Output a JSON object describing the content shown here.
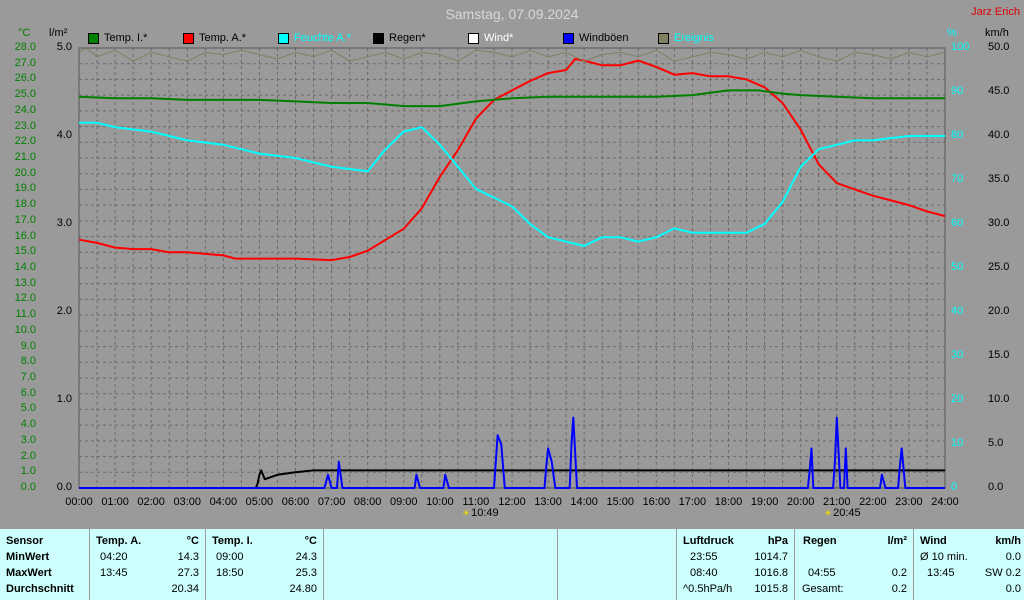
{
  "header": {
    "title": "Samstag, 07.09.2024",
    "author": "Jarz Erich"
  },
  "units": {
    "temp": "°C",
    "rain": "l/m²",
    "humidity": "%",
    "wind": "km/h"
  },
  "legend": [
    {
      "label": "Temp. I.*",
      "color": "#008000",
      "text_color": "#000000"
    },
    {
      "label": "Temp. A.*",
      "color": "#ff0000",
      "text_color": "#000000"
    },
    {
      "label": "Feuchte A.*",
      "color": "#00ffff",
      "text_color": "#00ffff"
    },
    {
      "label": "Regen*",
      "color": "#000000",
      "text_color": "#000000"
    },
    {
      "label": "Wind*",
      "color": "#ffffff",
      "text_color": "#ffffff"
    },
    {
      "label": "Windböen",
      "color": "#0000ff",
      "text_color": "#000000"
    },
    {
      "label": "Ereignis",
      "color": "#808060",
      "text_color": "#00ffff"
    }
  ],
  "colors": {
    "temp_axis": "#008000",
    "humidity_axis": "#00ffff",
    "wind_axis": "#000000",
    "plot_bg": "#9a9a9a",
    "grid": "#6a6a6a"
  },
  "sun": {
    "sunrise": "10:49",
    "sunset": "20:45"
  },
  "chart_data": {
    "type": "line",
    "title": "Samstag, 07.09.2024",
    "grid": true,
    "x": {
      "range": [
        0,
        24
      ],
      "ticks": [
        "00:00",
        "01:00",
        "02:00",
        "03:00",
        "04:00",
        "05:00",
        "06:00",
        "07:00",
        "08:00",
        "09:00",
        "10:00",
        "11:00",
        "12:00",
        "13:00",
        "14:00",
        "15:00",
        "16:00",
        "17:00",
        "18:00",
        "19:00",
        "20:00",
        "21:00",
        "22:00",
        "23:00",
        "24:00"
      ]
    },
    "axes": {
      "temp": {
        "ylim": [
          0,
          28
        ],
        "ticks": [
          "0.0",
          "1.0",
          "2.0",
          "3.0",
          "4.0",
          "5.0",
          "6.0",
          "7.0",
          "8.0",
          "9.0",
          "10.0",
          "11.0",
          "12.0",
          "13.0",
          "14.0",
          "15.0",
          "16.0",
          "17.0",
          "18.0",
          "19.0",
          "20.0",
          "21.0",
          "22.0",
          "23.0",
          "24.0",
          "25.0",
          "26.0",
          "27.0",
          "28.0"
        ]
      },
      "rain": {
        "ylim": [
          0,
          5
        ],
        "ticks": [
          "0.0",
          "1.0",
          "2.0",
          "3.0",
          "4.0",
          "5.0"
        ]
      },
      "humidity": {
        "ylim": [
          0,
          100
        ],
        "ticks": [
          "0",
          "10",
          "20",
          "30",
          "40",
          "50",
          "60",
          "70",
          "80",
          "90",
          "100"
        ]
      },
      "wind": {
        "ylim": [
          0,
          50
        ],
        "ticks": [
          "0.0",
          "5.0",
          "10.0",
          "15.0",
          "20.0",
          "25.0",
          "30.0",
          "35.0",
          "40.0",
          "45.0",
          "50.0"
        ]
      }
    },
    "series": [
      {
        "name": "Temp. A.*",
        "axis": "temp",
        "color": "#ff0000",
        "points": [
          [
            0,
            15.8
          ],
          [
            0.5,
            15.6
          ],
          [
            1,
            15.3
          ],
          [
            1.5,
            15.2
          ],
          [
            2,
            15.2
          ],
          [
            2.5,
            15.0
          ],
          [
            3,
            15.0
          ],
          [
            3.5,
            14.9
          ],
          [
            4,
            14.8
          ],
          [
            4.33,
            14.6
          ],
          [
            5,
            14.6
          ],
          [
            6,
            14.6
          ],
          [
            7,
            14.5
          ],
          [
            7.5,
            14.7
          ],
          [
            8,
            15.1
          ],
          [
            8.5,
            15.8
          ],
          [
            9,
            16.5
          ],
          [
            9.5,
            17.8
          ],
          [
            10,
            19.8
          ],
          [
            10.5,
            21.5
          ],
          [
            11,
            23.5
          ],
          [
            11.5,
            24.7
          ],
          [
            12,
            25.3
          ],
          [
            12.5,
            25.9
          ],
          [
            13,
            26.4
          ],
          [
            13.5,
            26.6
          ],
          [
            13.75,
            27.3
          ],
          [
            14,
            27.2
          ],
          [
            14.5,
            26.9
          ],
          [
            15,
            26.9
          ],
          [
            15.5,
            27.2
          ],
          [
            16,
            26.8
          ],
          [
            16.5,
            26.3
          ],
          [
            17,
            26.4
          ],
          [
            17.5,
            26.2
          ],
          [
            18,
            26.2
          ],
          [
            18.5,
            26.0
          ],
          [
            19,
            25.5
          ],
          [
            19.5,
            24.5
          ],
          [
            20,
            22.8
          ],
          [
            20.5,
            20.6
          ],
          [
            21,
            19.4
          ],
          [
            21.5,
            19.0
          ],
          [
            22,
            18.6
          ],
          [
            22.5,
            18.3
          ],
          [
            23,
            18.0
          ],
          [
            23.5,
            17.6
          ],
          [
            24,
            17.3
          ]
        ]
      },
      {
        "name": "Temp. I.*",
        "axis": "temp",
        "color": "#008000",
        "points": [
          [
            0,
            24.9
          ],
          [
            1,
            24.8
          ],
          [
            2,
            24.8
          ],
          [
            3,
            24.7
          ],
          [
            4,
            24.7
          ],
          [
            5,
            24.7
          ],
          [
            6,
            24.6
          ],
          [
            7,
            24.5
          ],
          [
            8,
            24.5
          ],
          [
            9,
            24.3
          ],
          [
            10,
            24.3
          ],
          [
            11,
            24.6
          ],
          [
            12,
            24.8
          ],
          [
            13,
            24.9
          ],
          [
            14,
            24.9
          ],
          [
            15,
            24.9
          ],
          [
            16,
            24.9
          ],
          [
            17,
            25.0
          ],
          [
            18,
            25.3
          ],
          [
            18.83,
            25.3
          ],
          [
            19.5,
            25.1
          ],
          [
            20,
            25.0
          ],
          [
            21,
            24.9
          ],
          [
            22,
            24.8
          ],
          [
            23,
            24.8
          ],
          [
            24,
            24.8
          ]
        ]
      },
      {
        "name": "Feuchte A.*",
        "axis": "humidity",
        "color": "#00ffff",
        "points": [
          [
            0,
            83
          ],
          [
            0.5,
            83
          ],
          [
            1,
            82
          ],
          [
            2,
            81
          ],
          [
            3,
            79
          ],
          [
            4,
            78
          ],
          [
            5,
            76
          ],
          [
            6,
            75
          ],
          [
            7,
            73
          ],
          [
            8,
            72
          ],
          [
            8.5,
            77
          ],
          [
            9,
            81
          ],
          [
            9.5,
            82
          ],
          [
            10,
            78
          ],
          [
            10.5,
            73
          ],
          [
            11,
            68
          ],
          [
            11.5,
            66
          ],
          [
            12,
            64
          ],
          [
            12.5,
            60
          ],
          [
            13,
            57
          ],
          [
            14,
            55
          ],
          [
            14.5,
            57
          ],
          [
            15,
            57
          ],
          [
            15.5,
            56
          ],
          [
            16,
            57
          ],
          [
            16.5,
            59
          ],
          [
            17,
            58
          ],
          [
            18,
            58
          ],
          [
            18.5,
            58
          ],
          [
            19,
            60
          ],
          [
            19.5,
            65
          ],
          [
            20,
            73
          ],
          [
            20.5,
            77
          ],
          [
            21,
            78
          ],
          [
            21.5,
            79
          ],
          [
            22,
            79
          ],
          [
            23,
            80
          ],
          [
            23.5,
            80
          ],
          [
            24,
            80
          ]
        ]
      },
      {
        "name": "Regen*",
        "axis": "rain",
        "color": "#000000",
        "points": [
          [
            0,
            0
          ],
          [
            4.9,
            0
          ],
          [
            4.95,
            0.05
          ],
          [
            5.0,
            0.15
          ],
          [
            5.05,
            0.2
          ],
          [
            5.15,
            0.1
          ],
          [
            5.5,
            0.15
          ],
          [
            6,
            0.18
          ],
          [
            6.5,
            0.2
          ],
          [
            7,
            0.2
          ],
          [
            24,
            0.2
          ]
        ]
      },
      {
        "name": "Windböen",
        "axis": "wind",
        "color": "#0000ff",
        "points": [
          [
            0,
            0
          ],
          [
            6.8,
            0
          ],
          [
            6.9,
            1.5
          ],
          [
            7.0,
            0
          ],
          [
            7.15,
            0
          ],
          [
            7.2,
            3
          ],
          [
            7.3,
            0
          ],
          [
            9.3,
            0
          ],
          [
            9.35,
            1.5
          ],
          [
            9.45,
            0
          ],
          [
            10.1,
            0
          ],
          [
            10.15,
            1.5
          ],
          [
            10.25,
            0
          ],
          [
            11.5,
            0
          ],
          [
            11.55,
            3
          ],
          [
            11.6,
            6
          ],
          [
            11.7,
            5
          ],
          [
            11.8,
            0
          ],
          [
            12.9,
            0
          ],
          [
            12.95,
            2.5
          ],
          [
            13.0,
            4.5
          ],
          [
            13.1,
            3
          ],
          [
            13.2,
            0
          ],
          [
            13.6,
            0
          ],
          [
            13.65,
            5
          ],
          [
            13.7,
            8
          ],
          [
            13.8,
            0
          ],
          [
            20.2,
            0
          ],
          [
            20.25,
            2
          ],
          [
            20.3,
            4.5
          ],
          [
            20.35,
            0
          ],
          [
            20.9,
            0
          ],
          [
            20.95,
            3
          ],
          [
            21.0,
            8
          ],
          [
            21.1,
            0
          ],
          [
            21.2,
            0
          ],
          [
            21.25,
            4.5
          ],
          [
            21.3,
            0
          ],
          [
            22.2,
            0
          ],
          [
            22.25,
            1.5
          ],
          [
            22.35,
            0
          ],
          [
            22.7,
            0
          ],
          [
            22.75,
            2.5
          ],
          [
            22.8,
            4.5
          ],
          [
            22.9,
            0
          ],
          [
            24,
            0
          ]
        ]
      },
      {
        "name": "Ereignis",
        "axis": "humidity",
        "color": "#808060",
        "points": [
          [
            0,
            99
          ],
          [
            0.2,
            100
          ],
          [
            0.5,
            98
          ],
          [
            1,
            99.5
          ],
          [
            1.5,
            97
          ],
          [
            2,
            99
          ],
          [
            2.5,
            98
          ],
          [
            3,
            97
          ],
          [
            3.5,
            99
          ],
          [
            4,
            98.5
          ],
          [
            4.5,
            99.5
          ],
          [
            5,
            98.5
          ],
          [
            5.5,
            97.5
          ],
          [
            6,
            99
          ],
          [
            6.5,
            98
          ],
          [
            7,
            99.5
          ],
          [
            7.5,
            97
          ],
          [
            8,
            98
          ],
          [
            8.5,
            99
          ],
          [
            9,
            97.5
          ],
          [
            9.5,
            99
          ],
          [
            10,
            98.5
          ],
          [
            10.5,
            97
          ],
          [
            11,
            99.5
          ],
          [
            11.5,
            99
          ],
          [
            12,
            98
          ],
          [
            12.5,
            99.5
          ],
          [
            13,
            98
          ],
          [
            13.5,
            99
          ],
          [
            14,
            97
          ],
          [
            14.5,
            98.5
          ],
          [
            15,
            99
          ],
          [
            15.5,
            98
          ],
          [
            16,
            99.5
          ],
          [
            16.5,
            97
          ],
          [
            17,
            98
          ],
          [
            17.5,
            99
          ],
          [
            18,
            98.5
          ],
          [
            18.5,
            97.5
          ],
          [
            19,
            99
          ],
          [
            19.5,
            98
          ],
          [
            20,
            99.5
          ],
          [
            20.5,
            98
          ],
          [
            21,
            97
          ],
          [
            21.5,
            99
          ],
          [
            22,
            98.5
          ],
          [
            22.5,
            97.5
          ],
          [
            23,
            99
          ],
          [
            23.5,
            98
          ],
          [
            24,
            99
          ]
        ]
      }
    ]
  },
  "summary": {
    "sensor": {
      "header": "Sensor",
      "rows": [
        "MinWert",
        "MaxWert",
        "Durchschnitt"
      ]
    },
    "temp_a": {
      "header": "Temp. A.",
      "unit": "°C",
      "min_time": "04:20",
      "min": "14.3",
      "max_time": "13:45",
      "max": "27.3",
      "avg": "20.34"
    },
    "temp_i": {
      "header": "Temp. I.",
      "unit": "°C",
      "min_time": "09:00",
      "min": "24.3",
      "max_time": "18:50",
      "max": "25.3",
      "avg": "24.80"
    },
    "pressure": {
      "header": "Luftdruck",
      "unit": "hPa",
      "min_time": "23:55",
      "min": "1014.7",
      "max_time": "08:40",
      "max": "1016.8",
      "avg_label": "^0.5hPa/h",
      "avg": "1015.8"
    },
    "rain": {
      "header": "Regen",
      "unit": "l/m²",
      "max_time": "04:55",
      "max": "0.2",
      "total_label": "Gesamt:",
      "total": "0.2"
    },
    "wind": {
      "header": "Wind",
      "unit": "km/h",
      "avg_label": "Ø 10 min.",
      "avg": "0.0",
      "max_time": "13:45",
      "max": "SW 0.2",
      "extra": "0.0"
    }
  }
}
